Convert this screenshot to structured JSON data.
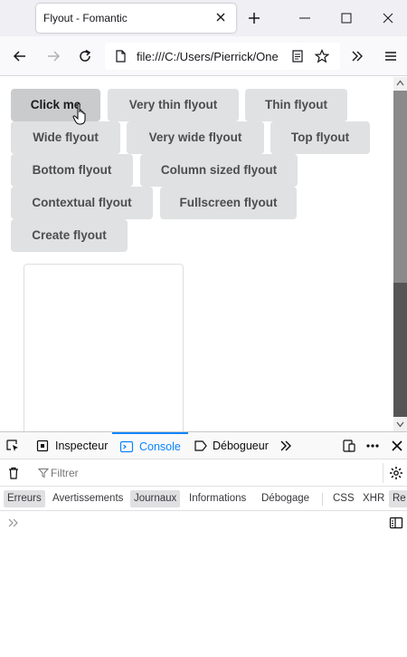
{
  "browser": {
    "tab_title": "Flyout - Fomantic",
    "url": "file:///C:/Users/Pierrick/One"
  },
  "page": {
    "buttons": [
      {
        "id": "click-me",
        "label": "Click me"
      },
      {
        "id": "very-thin",
        "label": "Very thin flyout"
      },
      {
        "id": "thin",
        "label": "Thin flyout"
      },
      {
        "id": "wide",
        "label": "Wide flyout"
      },
      {
        "id": "very-wide",
        "label": "Very wide flyout"
      },
      {
        "id": "top",
        "label": "Top flyout"
      },
      {
        "id": "bottom",
        "label": "Bottom flyout"
      },
      {
        "id": "column-sized",
        "label": "Column sized flyout"
      },
      {
        "id": "contextual",
        "label": "Contextual flyout"
      },
      {
        "id": "fullscreen",
        "label": "Fullscreen flyout"
      },
      {
        "id": "create",
        "label": "Create flyout"
      }
    ]
  },
  "devtools": {
    "tabs": {
      "inspector": "Inspecteur",
      "console": "Console",
      "debugger": "Débogueur"
    },
    "filter_placeholder": "Filtrer",
    "levels": {
      "errors": "Erreurs",
      "warnings": "Avertissements",
      "logs": "Journaux",
      "info": "Informations",
      "debug": "Débogage",
      "css": "CSS",
      "xhr": "XHR",
      "requests": "Re"
    }
  },
  "colors": {
    "accent": "#0a84ff",
    "button_bg": "#e0e1e2",
    "button_active_bg": "#cacbcd"
  }
}
